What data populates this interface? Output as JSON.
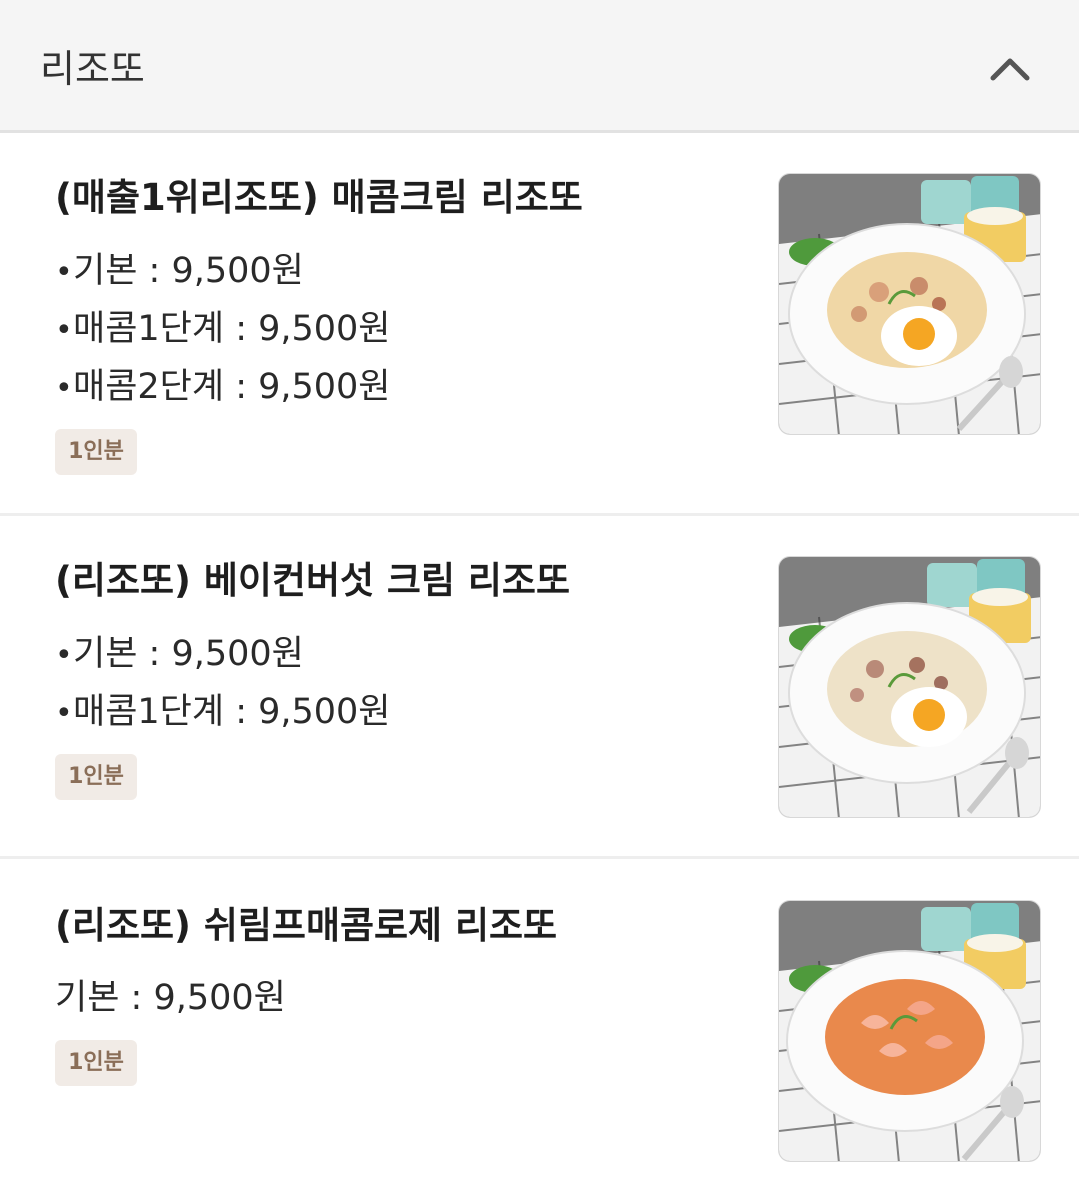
{
  "section": {
    "title": "리조또",
    "collapse_icon": "chevron-up-icon"
  },
  "items": [
    {
      "name": "(매출1위리조또) 매콤크림 리조또",
      "prices": [
        {
          "bullet": "•",
          "text": "기본 : 9,500원"
        },
        {
          "bullet": "•",
          "text": "매콤1단계 : 9,500원"
        },
        {
          "bullet": "•",
          "text": "매콤2단계 : 9,500원"
        }
      ],
      "badge": "1인분",
      "sauce_color": "#f0d7a6"
    },
    {
      "name": "(리조또) 베이컨버섯 크림 리조또",
      "prices": [
        {
          "bullet": "•",
          "text": "기본 : 9,500원"
        },
        {
          "bullet": "•",
          "text": "매콤1단계 : 9,500원"
        }
      ],
      "badge": "1인분",
      "sauce_color": "#eee2c8"
    },
    {
      "name": "(리조또) 쉬림프매콤로제 리조또",
      "prices": [
        {
          "bullet": "",
          "text": "기본 : 9,500원"
        }
      ],
      "badge": "1인분",
      "sauce_color": "#e9894c"
    }
  ]
}
